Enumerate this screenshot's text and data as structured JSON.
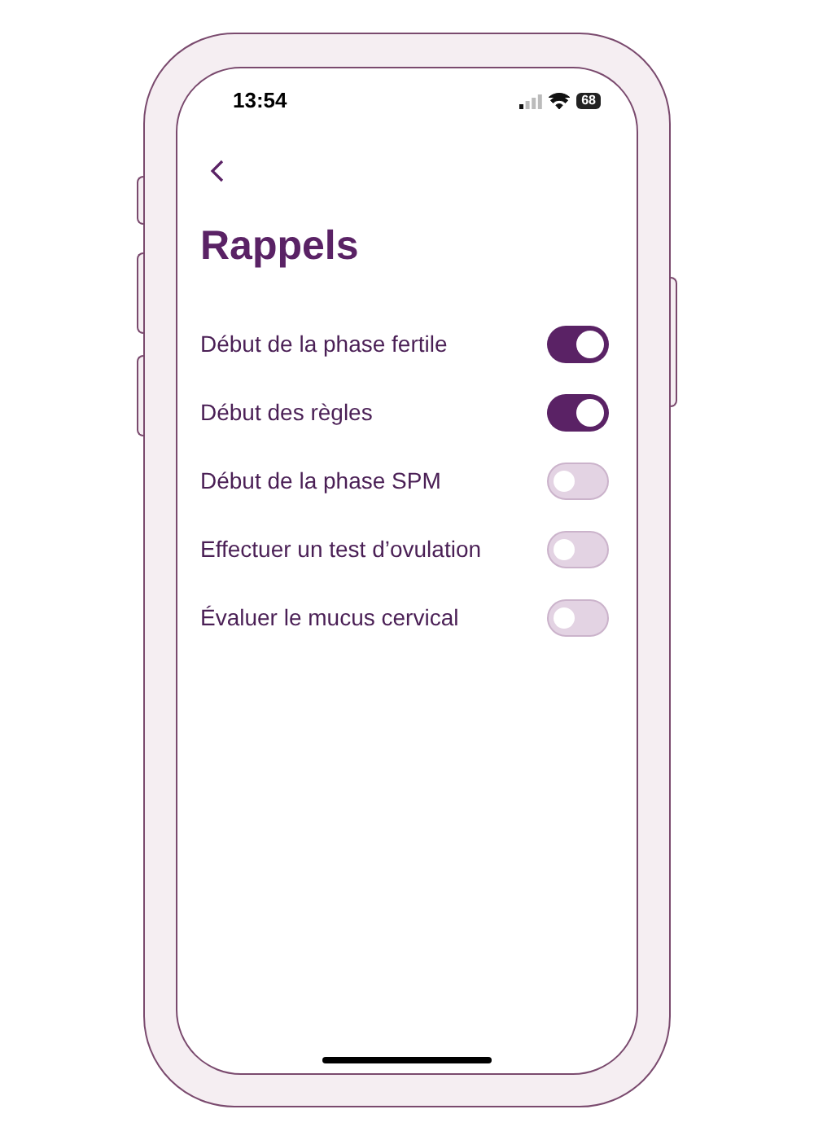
{
  "status_bar": {
    "time": "13:54",
    "battery": "68"
  },
  "title": "Rappels",
  "reminders": [
    {
      "label": "Début de la phase fertile",
      "on": true
    },
    {
      "label": "Début des règles",
      "on": true
    },
    {
      "label": "Début de la phase SPM",
      "on": false
    },
    {
      "label": "Effectuer un test d’ovulation",
      "on": false
    },
    {
      "label": "Évaluer le mucus cervical",
      "on": false
    }
  ]
}
